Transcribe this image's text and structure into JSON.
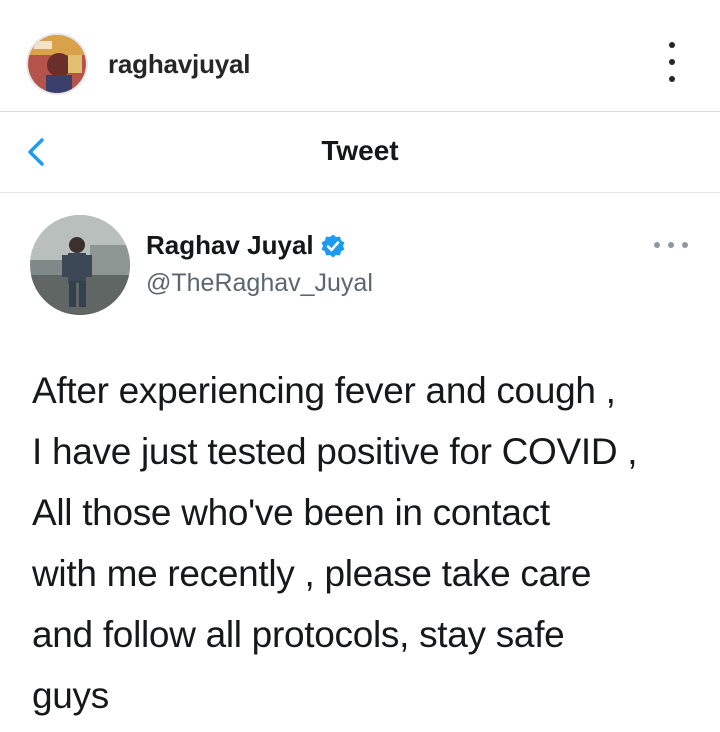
{
  "instagram": {
    "username": "raghavjuyal",
    "avatar_icon": "profile-avatar",
    "menu_icon": "kebab-menu-icon"
  },
  "twitter_nav": {
    "title": "Tweet",
    "back_icon": "chevron-left-icon"
  },
  "tweet": {
    "author_name": "Raghav Juyal",
    "handle": "@TheRaghav_Juyal",
    "verified_icon": "verified-badge-icon",
    "more_icon": "more-options-icon",
    "text_lines": [
      "After experiencing fever and cough ,",
      "I have just tested positive for COVID ,",
      "All those who've been in contact",
      "with me recently , please take care",
      "and follow all protocols, stay safe",
      "guys"
    ]
  },
  "colors": {
    "twitter_blue": "#1d9bf0",
    "handle_gray": "#5b6670"
  }
}
